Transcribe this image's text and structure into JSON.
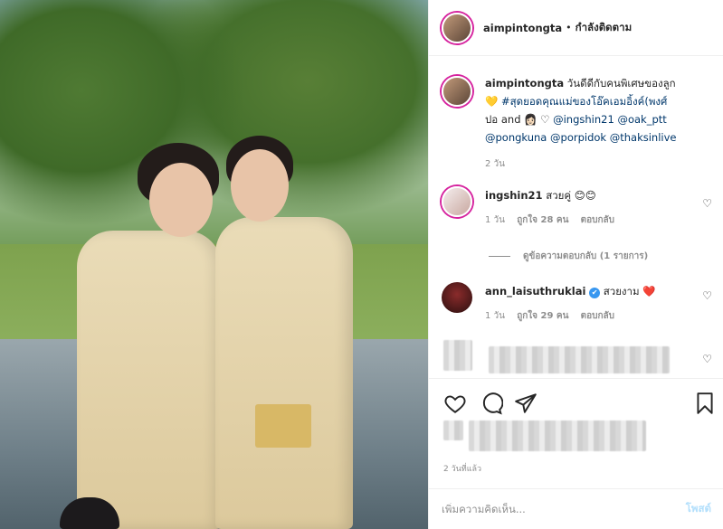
{
  "header": {
    "username": "aimpintongta",
    "separator": "•",
    "follow_label": "กำลังติดตาม"
  },
  "caption": {
    "username": "aimpintongta",
    "line1": "วันดีดีกับคนพิเศษของลูก",
    "line2_emoji": "💛",
    "line2_tag": "#สุดยอดคุณแม่ของโอ๊คเอมอิ้งค์(พงศ์",
    "line3_pre": "ปอ and",
    "line3_emoji": "👩🏻",
    "line3_heart": "♡",
    "mention1": "@ingshin21",
    "mention2": "@oak_ptt",
    "mention3": "@pongkuna",
    "mention4": "@porpidok",
    "mention5": "@thaksinlive",
    "time": "2 วัน"
  },
  "comments": [
    {
      "username": "ingshin21",
      "text": "สวยคู่",
      "emoji": "😊😊",
      "time": "1 วัน",
      "likes": "ถูกใจ 28 คน",
      "reply": "ตอบกลับ",
      "view_replies": "ดูข้อความตอบกลับ (1 รายการ)"
    },
    {
      "username": "ann_laisuthruklai",
      "verified": "✔",
      "text": "สวยงาม",
      "emoji": "❤️",
      "time": "1 วัน",
      "likes": "ถูกใจ 29 คน",
      "reply": "ตอบกลับ"
    }
  ],
  "likes": {
    "time": "2 วันที่แล้ว"
  },
  "add_comment": {
    "placeholder": "เพิ่มความคิดเห็น...",
    "post_label": "โพสต์"
  },
  "icons": {
    "like": "heart-icon",
    "comment": "comment-icon",
    "share": "share-icon",
    "save": "bookmark-icon"
  },
  "colors": {
    "link": "#00376b",
    "meta": "#8e8e8e",
    "heart_red": "#ed4956",
    "post_disabled": "#b2dffc",
    "verified": "#3897f0"
  }
}
